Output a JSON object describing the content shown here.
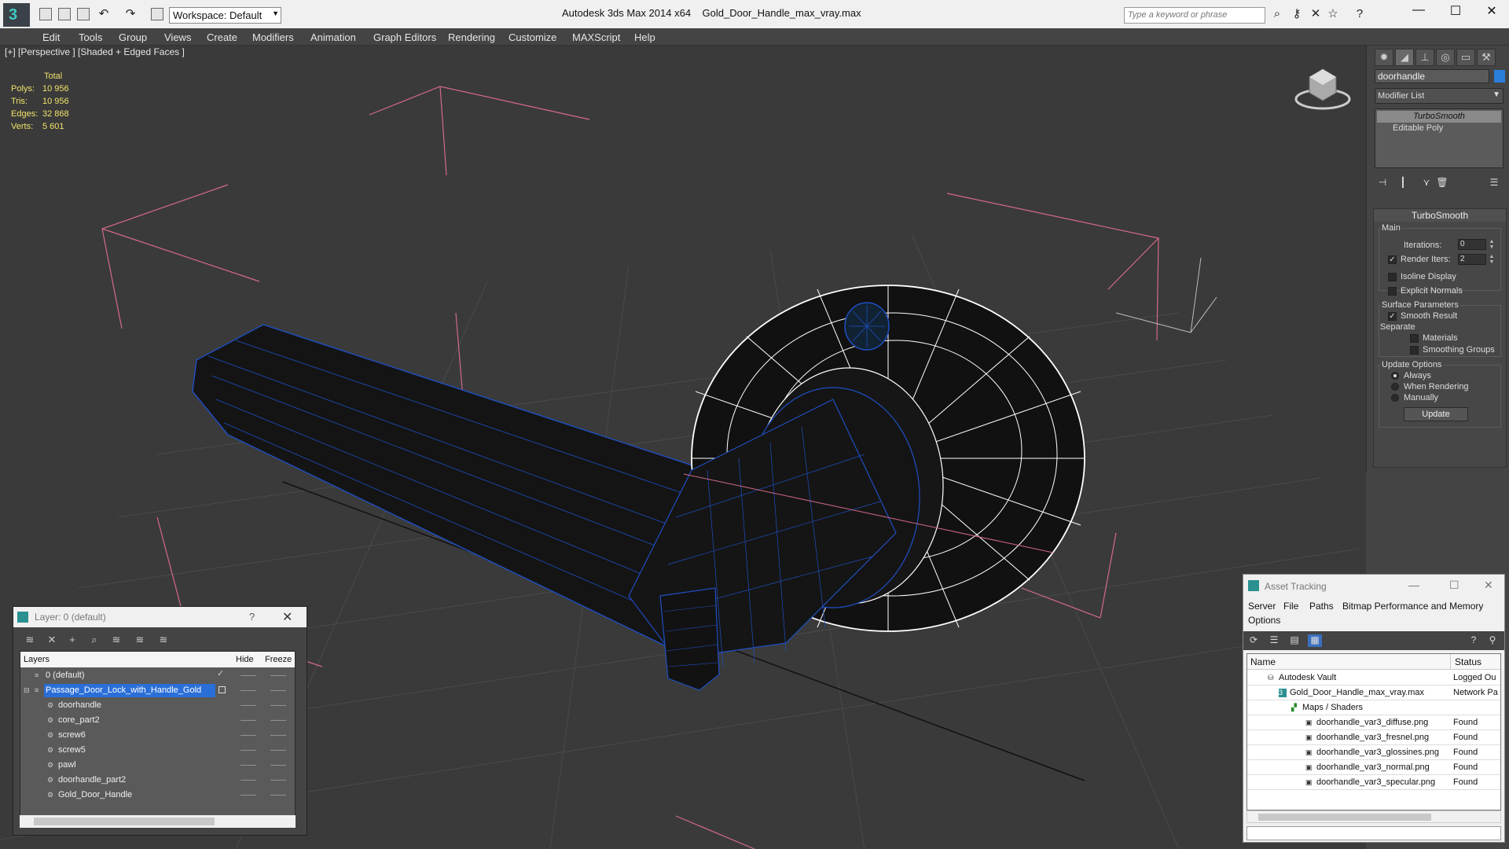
{
  "titlebar": {
    "workspace": "Workspace: Default",
    "app": "Autodesk 3ds Max  2014 x64",
    "file": "Gold_Door_Handle_max_vray.max",
    "search_placeholder": "Type a keyword or phrase"
  },
  "menu": [
    "Edit",
    "Tools",
    "Group",
    "Views",
    "Create",
    "Modifiers",
    "Animation",
    "Graph Editors",
    "Rendering",
    "Customize",
    "MAXScript",
    "Help"
  ],
  "viewport": {
    "label": "[+] [Perspective ] [Shaded + Edged Faces ]",
    "stats": {
      "header": "Total",
      "polys_label": "Polys:",
      "polys": "10 956",
      "tris_label": "Tris:",
      "tris": "10 956",
      "edges_label": "Edges:",
      "edges": "32 868",
      "verts_label": "Verts:",
      "verts": "5 601"
    }
  },
  "command_panel": {
    "object_name": "doorhandle",
    "object_color": "#2b7fd9",
    "modifier_list": "Modifier List",
    "stack": [
      "TurboSmooth",
      "Editable Poly"
    ],
    "rollout": {
      "title": "TurboSmooth",
      "main": "Main",
      "iterations_label": "Iterations:",
      "iterations": "0",
      "render_iters_label": "Render Iters:",
      "render_iters": "2",
      "isoline": "Isoline Display",
      "explicit": "Explicit Normals",
      "surface": "Surface Parameters",
      "smooth_result": "Smooth Result",
      "separate": "Separate",
      "materials": "Materials",
      "smoothing_groups": "Smoothing Groups",
      "update_options": "Update Options",
      "always": "Always",
      "when_rendering": "When Rendering",
      "manually": "Manually",
      "update_btn": "Update"
    }
  },
  "layer_dialog": {
    "title": "Layer: 0 (default)",
    "help": "?",
    "col_layers": "Layers",
    "col_hide": "Hide",
    "col_freeze": "Freeze",
    "rows": [
      "0 (default)",
      "Passage_Door_Lock_with_Handle_Gold",
      "doorhandle",
      "core_part2",
      "screw6",
      "screw5",
      "pawl",
      "doorhandle_part2",
      "Gold_Door_Handle"
    ]
  },
  "asset_dialog": {
    "title": "Asset Tracking",
    "menu": [
      "Server",
      "File",
      "Paths",
      "Bitmap Performance and Memory",
      "Options"
    ],
    "col_name": "Name",
    "col_status": "Status",
    "rows": [
      {
        "name": "Autodesk Vault",
        "status": "Logged Ou"
      },
      {
        "name": "Gold_Door_Handle_max_vray.max",
        "status": "Network Pa"
      },
      {
        "name": "Maps / Shaders",
        "status": ""
      },
      {
        "name": "doorhandle_var3_diffuse.png",
        "status": "Found"
      },
      {
        "name": "doorhandle_var3_fresnel.png",
        "status": "Found"
      },
      {
        "name": "doorhandle_var3_glossines.png",
        "status": "Found"
      },
      {
        "name": "doorhandle_var3_normal.png",
        "status": "Found"
      },
      {
        "name": "doorhandle_var3_specular.png",
        "status": "Found"
      }
    ]
  }
}
